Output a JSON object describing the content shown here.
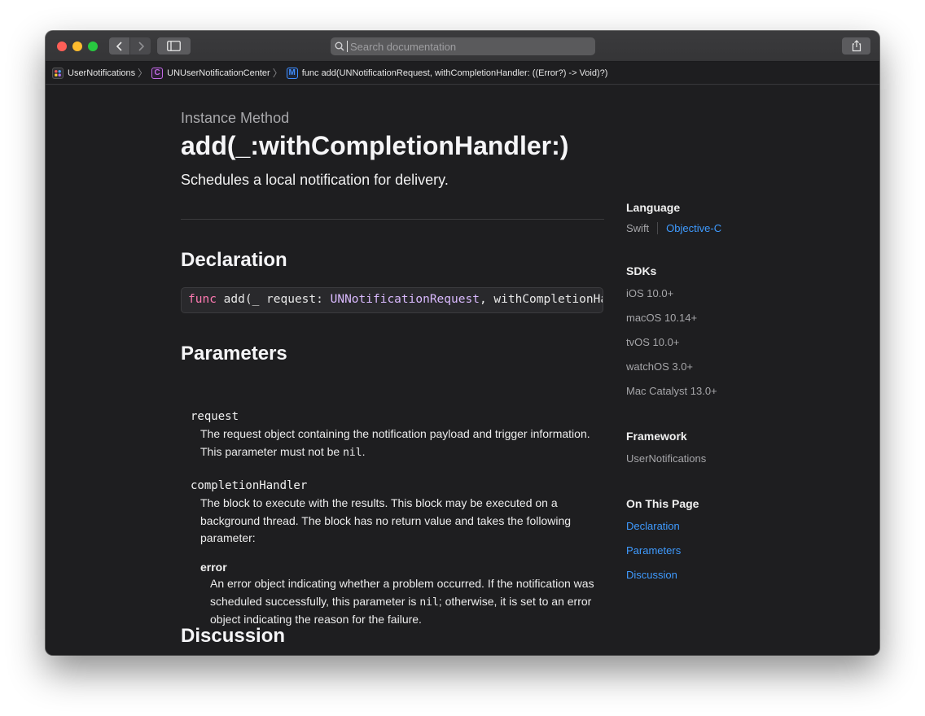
{
  "search": {
    "placeholder": "Search documentation"
  },
  "breadcrumb": [
    {
      "label": "UserNotifications",
      "icon": "framework-icon"
    },
    {
      "label": "UNUserNotificationCenter",
      "icon": "class-icon",
      "badge": "C"
    },
    {
      "label": "func add(UNNotificationRequest, withCompletionHandler: ((Error?) -> Void)?)",
      "icon": "method-icon",
      "badge": "M"
    }
  ],
  "doc": {
    "eyebrow": "Instance Method",
    "title": "add(_:withCompletionHandler:)",
    "abstract": "Schedules a local notification for delivery.",
    "declaration_heading": "Declaration",
    "declaration": {
      "kw": "func",
      "mid": " add(_ request: ",
      "type": "UNNotificationRequest",
      "rest": ", withCompletionHandler: ((Error?) -> Void)?)"
    },
    "parameters_heading": "Parameters",
    "params": [
      {
        "name": "request",
        "desc_a": "The request object containing the notification payload and trigger information. This parameter must not be ",
        "desc_code": "nil",
        "desc_b": "."
      },
      {
        "name": "completionHandler",
        "desc": "The block to execute with the results. This block may be executed on a background thread. The block has no return value and takes the following parameter:",
        "sub_name": "error",
        "sub_desc_a": "An error object indicating whether a problem occurred. If the notification was scheduled successfully, this parameter is ",
        "sub_desc_code": "nil",
        "sub_desc_b": "; otherwise, it is set to an error object indicating the reason for the failure."
      }
    ],
    "discussion_heading": "Discussion"
  },
  "aside": {
    "language_heading": "Language",
    "languages": [
      "Swift",
      "Objective-C"
    ],
    "sdks_heading": "SDKs",
    "sdks": [
      "iOS 10.0+",
      "macOS 10.14+",
      "tvOS 10.0+",
      "watchOS 3.0+",
      "Mac Catalyst 13.0+"
    ],
    "framework_heading": "Framework",
    "framework": "UserNotifications",
    "on_this_page_heading": "On This Page",
    "on_this_page": [
      "Declaration",
      "Parameters",
      "Discussion"
    ]
  },
  "colors": {
    "link": "#3f9bff",
    "keyword": "#ff7ab2",
    "type": "#dabaff",
    "background": "#1e1e20"
  }
}
